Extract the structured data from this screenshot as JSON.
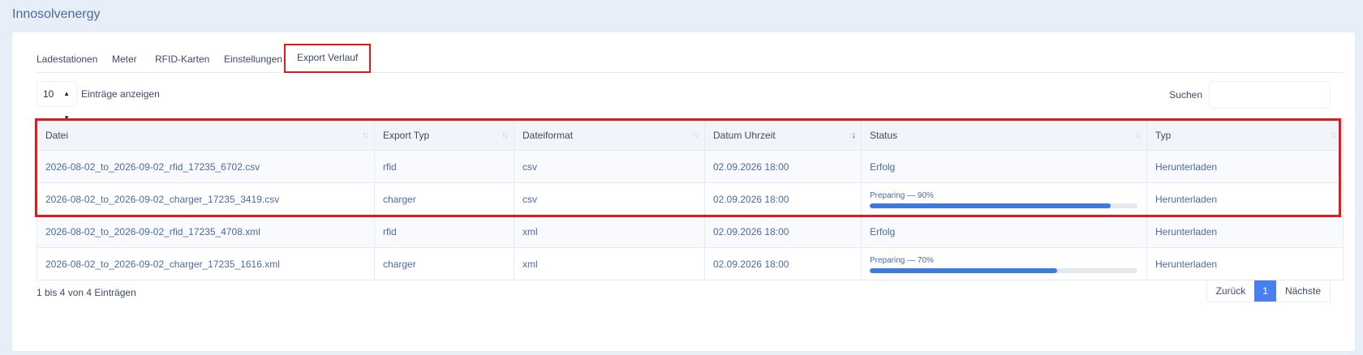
{
  "app": {
    "title": "Innosolvenergy"
  },
  "tabs": [
    {
      "label": "Ladestationen",
      "active": false
    },
    {
      "label": "Meter",
      "active": false
    },
    {
      "label": "RFID-Karten",
      "active": false
    },
    {
      "label": "Einstellungen",
      "active": false
    },
    {
      "label": "Export Verlauf",
      "active": true
    }
  ],
  "length": {
    "value": "10",
    "label": "Einträge anzeigen"
  },
  "search": {
    "label": "Suchen",
    "value": ""
  },
  "table": {
    "columns": [
      "Datei",
      "Export Typ",
      "Dateiformat",
      "Datum Uhrzeit",
      "Status",
      "Typ"
    ],
    "rows": [
      {
        "file": "2026-08-02_to_2026-09-02_rfid_17235_6702.csv",
        "export_type": "rfid",
        "format": "csv",
        "datetime": "02.09.2026 18:00",
        "status": "Erfolg",
        "progress": null,
        "type": "Herunterladen"
      },
      {
        "file": "2026-08-02_to_2026-09-02_charger_17235_3419.csv",
        "export_type": "charger",
        "format": "csv",
        "datetime": "02.09.2026 18:00",
        "status": "Preparing — 90%",
        "progress": 0.9,
        "type": "Herunterladen"
      },
      {
        "file": "2026-08-02_to_2026-09-02_rfid_17235_4708.xml",
        "export_type": "rfid",
        "format": "xml",
        "datetime": "02.09.2026 18:00",
        "status": "Erfolg",
        "progress": null,
        "type": "Herunterladen"
      },
      {
        "file": "2026-08-02_to_2026-09-02_charger_17235_1616.xml",
        "export_type": "charger",
        "format": "xml",
        "datetime": "02.09.2026 18:00",
        "status": "Preparing — 70%",
        "progress": 0.7,
        "type": "Herunterladen"
      }
    ]
  },
  "footer": {
    "info": "1 bis 4 von 4 Einträgen",
    "prev_label": "Zurück",
    "current_page": "1",
    "next_label": "Nächste"
  },
  "colors": {
    "accent": "#3b7ae3",
    "highlight": "#e11b1b",
    "page_bg": "#e8eef7"
  }
}
